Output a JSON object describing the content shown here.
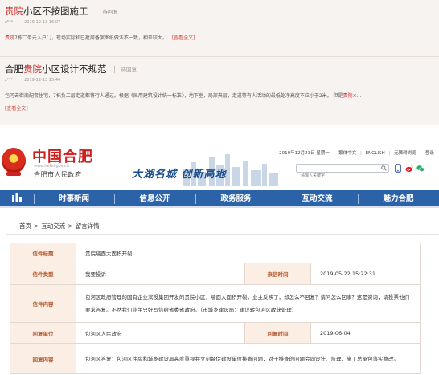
{
  "qa_list": [
    {
      "title_hl": "贵院",
      "title_rest": "小区不按图施工",
      "status": "待回复",
      "user": "z***",
      "date": "2019-12-13 16:07",
      "body_hl": "贵院",
      "body_rest": "7栋二单元入户门，现场实际和已批周备案图纸做法不一致，相差较大。",
      "more": "[查看全文]"
    },
    {
      "title_pre": "合肥",
      "title_hl": "贵院",
      "title_rest": "小区设计不规范",
      "status": "待回复",
      "user": "z***",
      "date": "2019-12-13 15:44",
      "body_pre": "包河去街南配套住宅，7栋负二层走道都将行人通过。根据《民用建筑设计统一标准》，地下室，局部夹层，走道等有人活动的最低处净高度不应小于2米。 但是",
      "body_hl": "贵院",
      "body_rest": "×...",
      "more": "[查看全文]"
    }
  ],
  "header": {
    "logo_text": "中国合肥",
    "logo_url": "www.hefei.gov.cn",
    "logo_sub": "合肥市人民政府",
    "slogan": "大湖名城  创新高地",
    "date": "2019年12月23日 星期一",
    "links": [
      "繁体中文",
      "ENGLISH",
      "无障碍浏览",
      "登录"
    ],
    "search_placeholder": "请输入关键字"
  },
  "nav": {
    "items": [
      "时事新闻",
      "信息公开",
      "政务服务",
      "互动交流",
      "魅力合肥"
    ]
  },
  "breadcrumb": [
    "首页",
    "互动交流",
    "留言详情"
  ],
  "detail": {
    "labels": {
      "title": "信件标题",
      "type": "信件类型",
      "sent": "来信时间",
      "content": "信件内容",
      "unit": "回复单位",
      "reply_time": "回复时间",
      "reply": "回复内容"
    },
    "title": "贵院墙面大面积开裂",
    "type": "我要投诉",
    "sent": "2019-05-22 15:22:31",
    "content": "包河区政府管理的国有企业滨投集团开发的贵院小区，墙面大面积开裂，业主反映了，却怎么不回复？请问怎么回事？这是资询，请投票他们要求答复。不然我们业主只好写信给省委省政府。（市城乡建设局：建议转包河区政获处理）",
    "unit": "包河区人民政府",
    "reply_time": "2019-06-04",
    "reply": "包河区答复：包河区住房和城乡建设局高度重视并立刻督促建设单位排查问题，对于排查的问题会同设计、监理、施工总承包落实整改。"
  },
  "colors": {
    "brand_red": "#cc1f1f",
    "nav_blue": "#2c63a8",
    "label_bg": "#fbeee4",
    "label_text": "#b55a30"
  }
}
